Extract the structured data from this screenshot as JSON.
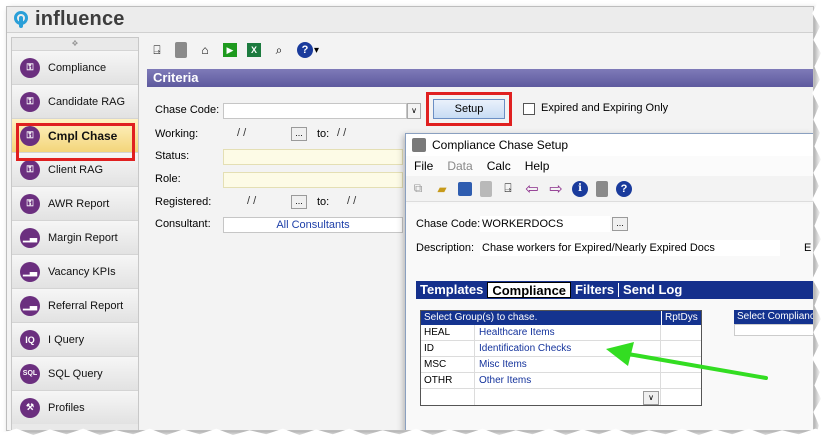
{
  "app": {
    "logo_text": "influence"
  },
  "sidebar": {
    "grip": "❖",
    "items": [
      {
        "label": "Compliance",
        "icon": "lock-icon",
        "glyph": "⚿"
      },
      {
        "label": "Candidate RAG",
        "icon": "lock-icon",
        "glyph": "⚿"
      },
      {
        "label": "Cmpl Chase",
        "icon": "lock-icon",
        "glyph": "⚿"
      },
      {
        "label": "Client RAG",
        "icon": "lock-icon",
        "glyph": "⚿"
      },
      {
        "label": "AWR Report",
        "icon": "lock-icon",
        "glyph": "⚿"
      },
      {
        "label": "Margin Report",
        "icon": "bar-chart-icon",
        "glyph": "▁▃"
      },
      {
        "label": "Vacancy KPIs",
        "icon": "bar-chart-icon",
        "glyph": "▁▃"
      },
      {
        "label": "Referral Report",
        "icon": "bar-chart-icon",
        "glyph": "▁▃"
      },
      {
        "label": "I Query",
        "icon": "iq-icon",
        "glyph": "IQ"
      },
      {
        "label": "SQL Query",
        "icon": "sql-icon",
        "glyph": "SQL"
      },
      {
        "label": "Profiles",
        "icon": "wrench-icon",
        "glyph": "⚒"
      }
    ],
    "active_index": 2
  },
  "toolbar": {
    "exit_glyph": "⍈",
    "home_glyph": "⌂",
    "run_glyph": "▶",
    "excel_glyph": "X",
    "search_glyph": "⌕",
    "help_glyph": "?",
    "dropdown_glyph": "▾"
  },
  "criteria": {
    "title": "Criteria",
    "chase_code_label": "Chase Code:",
    "chase_code_value": "",
    "setup_label": "Setup",
    "expired_label": "Expired and Expiring Only",
    "working_label": "Working:",
    "to_label": "to:",
    "date_placeholder": "/ /",
    "status_label": "Status:",
    "role_label": "Role:",
    "registered_label": "Registered:",
    "consultant_label": "Consultant:",
    "consultant_value": "All Consultants",
    "ellipsis": "...",
    "combo_arrow": "∨"
  },
  "dialog": {
    "title": "Compliance Chase Setup",
    "menu": {
      "file": "File",
      "data": "Data",
      "calc": "Calc",
      "help": "Help"
    },
    "chase_code_label": "Chase Code:",
    "chase_code_value": "WORKERDOCS",
    "description_label": "Description:",
    "description_value": "Chase workers for Expired/Nearly Expired Docs",
    "edge_letter": "E",
    "tabs": [
      "Templates",
      "Compliance",
      "Filters",
      "Send Log"
    ],
    "active_tab": 1,
    "groups_header": "Select Group(s) to chase.",
    "rptdys_header": "RptDys",
    "groups": [
      {
        "code": "HEAL",
        "name": "Healthcare Items",
        "rpt": ""
      },
      {
        "code": "ID",
        "name": "Identification Checks",
        "rpt": ""
      },
      {
        "code": "MSC",
        "name": "Misc Items",
        "rpt": ""
      },
      {
        "code": "OTHR",
        "name": "Other Items",
        "rpt": ""
      }
    ],
    "compliance_header": "Select Compliance",
    "dropdown_glyph": "∨"
  },
  "colors": {
    "accent_purple": "#6b2f7f",
    "criteria_bar": "#6a66a8",
    "grid_header": "#14338f",
    "highlight_red": "#e02020",
    "arrow_green": "#33dd22"
  }
}
